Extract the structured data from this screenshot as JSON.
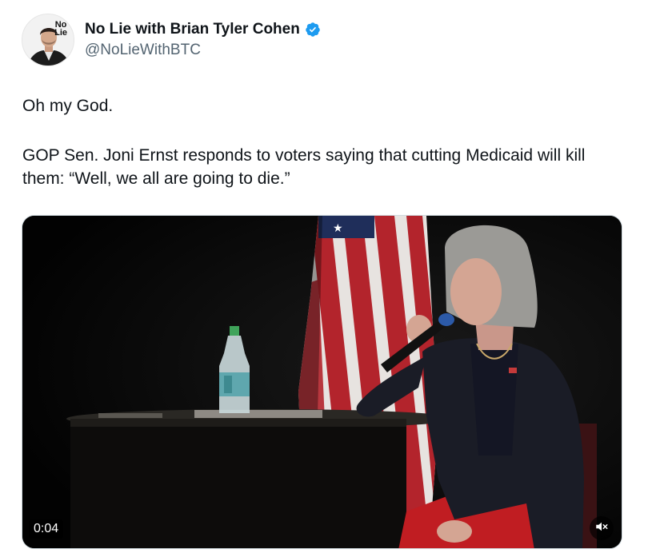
{
  "tweet": {
    "author": {
      "display_name": "No Lie with Brian Tyler Cohen",
      "handle": "@NoLieWithBTC",
      "verified": true,
      "avatar_logo_line1": "No",
      "avatar_logo_line2": "Lie"
    },
    "text_line1": "Oh my God.",
    "text_line2": "GOP Sen. Joni Ernst responds to voters saying that cutting Medicaid will kill them: “Well, we all are going to die.”",
    "media": {
      "type": "video",
      "timestamp": "0:04",
      "muted": true
    }
  },
  "colors": {
    "verified_badge": "#1d9bf0",
    "handle": "#536471",
    "text": "#0f1419"
  },
  "icons": [
    "verified-badge-icon",
    "speaker-muted-icon"
  ]
}
